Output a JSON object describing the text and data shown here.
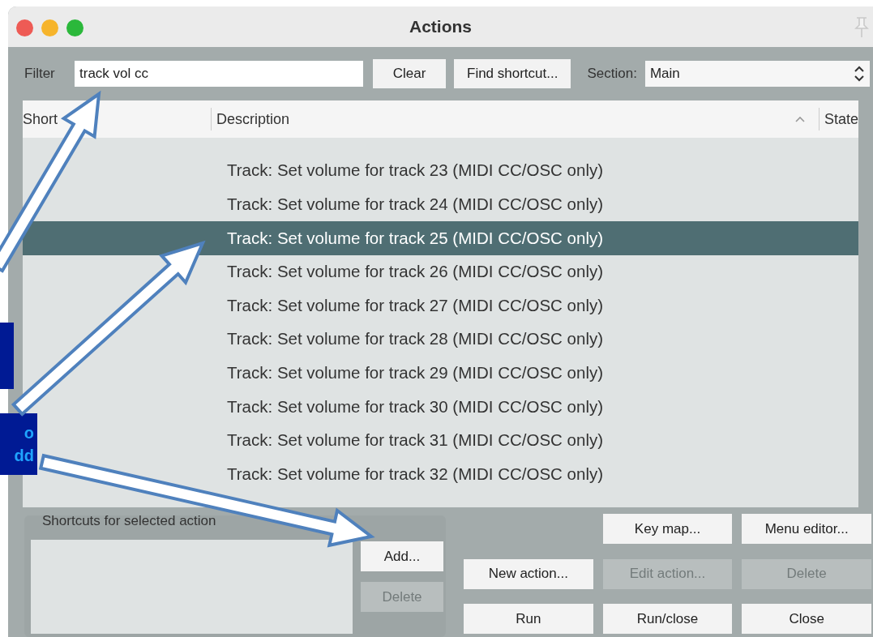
{
  "window": {
    "title": "Actions"
  },
  "filter": {
    "label": "Filter",
    "value": "track vol cc"
  },
  "top_buttons": [
    {
      "label": "Clear"
    },
    {
      "label": "Find shortcut..."
    }
  ],
  "section": {
    "label": "Section:",
    "value": "Main"
  },
  "table": {
    "columns": [
      {
        "label": "Short"
      },
      {
        "label": "Description",
        "sorted": true
      },
      {
        "label": "State"
      }
    ],
    "rows": [
      {
        "description": "Track: Set volume for track 23 (MIDI CC/OSC only)",
        "selected": false
      },
      {
        "description": "Track: Set volume for track 24 (MIDI CC/OSC only)",
        "selected": false
      },
      {
        "description": "Track: Set volume for track 25 (MIDI CC/OSC only)",
        "selected": true
      },
      {
        "description": "Track: Set volume for track 26 (MIDI CC/OSC only)",
        "selected": false
      },
      {
        "description": "Track: Set volume for track 27 (MIDI CC/OSC only)",
        "selected": false
      },
      {
        "description": "Track: Set volume for track 28 (MIDI CC/OSC only)",
        "selected": false
      },
      {
        "description": "Track: Set volume for track 29 (MIDI CC/OSC only)",
        "selected": false
      },
      {
        "description": "Track: Set volume for track 30 (MIDI CC/OSC only)",
        "selected": false
      },
      {
        "description": "Track: Set volume for track 31 (MIDI CC/OSC only)",
        "selected": false
      },
      {
        "description": "Track: Set volume for track 32 (MIDI CC/OSC only)",
        "selected": false
      }
    ]
  },
  "shortcuts": {
    "label": "Shortcuts for selected action",
    "buttons": [
      {
        "label": "Add...",
        "disabled": false
      },
      {
        "label": "Delete",
        "disabled": true
      }
    ]
  },
  "action_buttons": [
    {
      "label": "Key map...",
      "disabled": false
    },
    {
      "label": "Menu editor...",
      "disabled": false
    },
    {
      "label": "New action...",
      "disabled": false
    },
    {
      "label": "Edit action...",
      "disabled": true
    },
    {
      "label": "Delete",
      "disabled": true
    },
    {
      "label": "Run",
      "disabled": false
    },
    {
      "label": "Run/close",
      "disabled": false
    },
    {
      "label": "Close",
      "disabled": false
    }
  ],
  "annotations": [
    {
      "kind": "blank"
    },
    {
      "kind": "text",
      "lines": [
        "o",
        "dd"
      ]
    }
  ]
}
